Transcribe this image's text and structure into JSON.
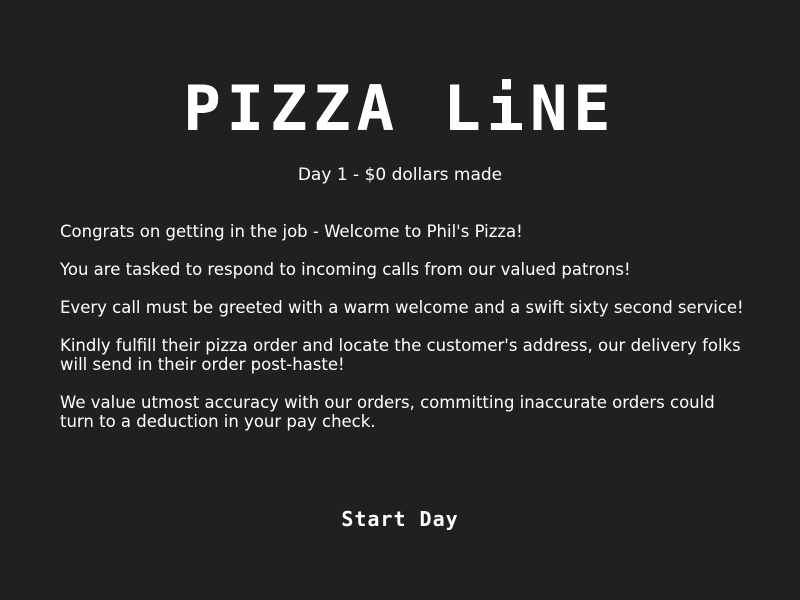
{
  "title": "PIZZA LiNE",
  "subtitle": "Day 1 - $0 dollars made",
  "intro": {
    "paragraphs": [
      "Congrats on getting in the job - Welcome to Phil's Pizza!",
      "You are tasked to respond to incoming calls from our valued patrons!",
      "Every call must be greeted with a warm welcome and a swift sixty second service!",
      "Kindly fulfill their pizza order and locate the customer's address, our delivery folks will send in their order post-haste!",
      "We value utmost accuracy with our orders, committing inaccurate orders could turn to a deduction in your pay check."
    ]
  },
  "start_button": {
    "label": "Start Day"
  },
  "colors": {
    "background": "#221f1f",
    "text": "#ffffff"
  }
}
